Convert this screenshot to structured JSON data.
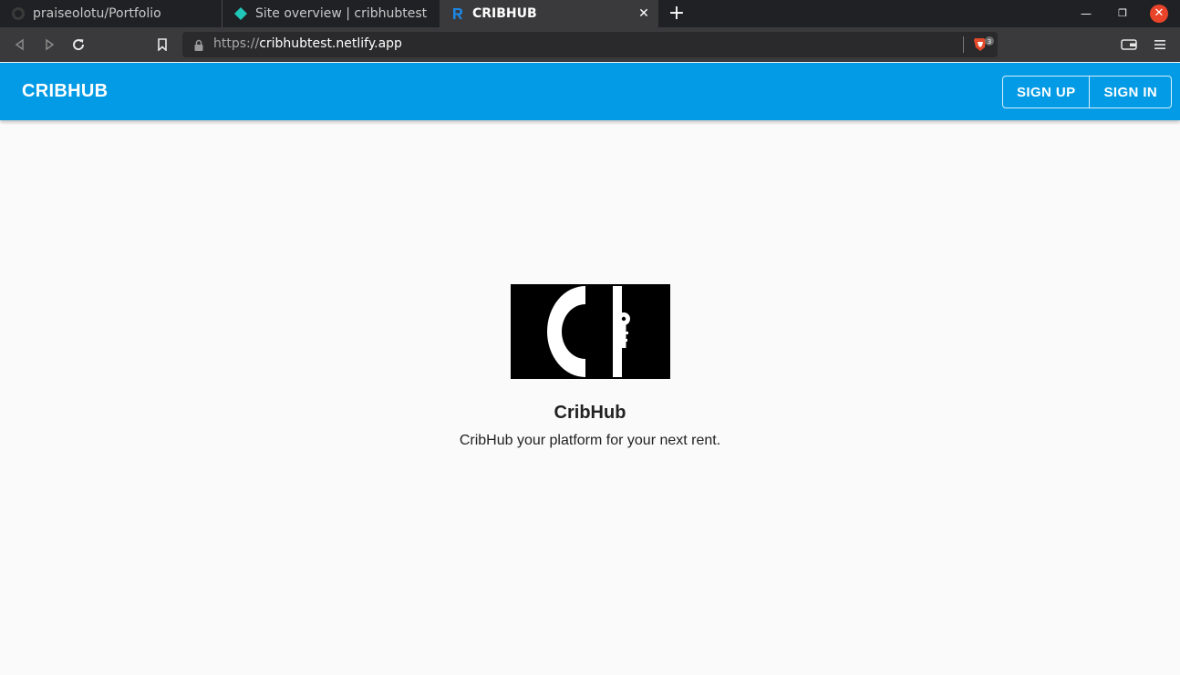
{
  "browser": {
    "tabs": [
      {
        "title": "praiseolotu/Portfolio",
        "icon": "github-icon"
      },
      {
        "title": "Site overview | cribhubtest",
        "icon": "netlify-icon"
      },
      {
        "title": "CRIBHUB",
        "icon": "react-icon",
        "active": true
      }
    ],
    "address": {
      "scheme": "https://",
      "host": "cribhubtest.netlify.app"
    },
    "shields_count": "3",
    "colors": {
      "tabbar": "#202124",
      "toolbar": "#3a3a3c",
      "close": "#e9432a"
    }
  },
  "app": {
    "brand": "CRIBHUB",
    "nav": {
      "sign_up": "SIGN UP",
      "sign_in": "SIGN IN"
    },
    "hero": {
      "logo": "cribhub-logo",
      "title": "CribHub",
      "subtitle": "CribHub your platform for your next rent."
    },
    "colors": {
      "appbar": "#039be5",
      "background": "#fafafa"
    }
  }
}
